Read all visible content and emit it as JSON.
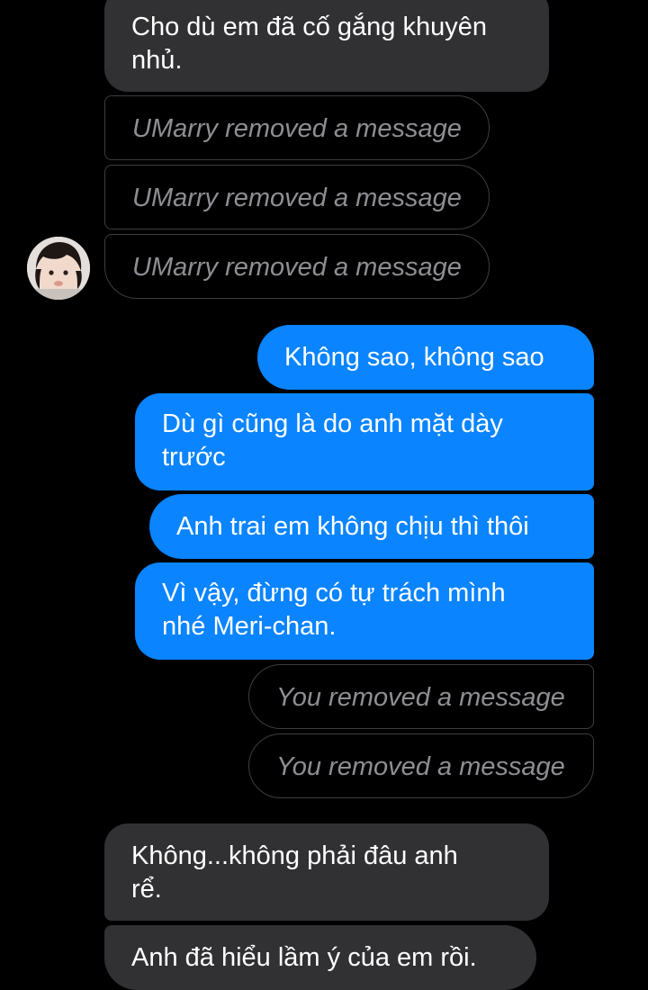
{
  "conversation": {
    "incoming_top": {
      "text_line1": "Cho dù em đã cố gắng khuyên",
      "text_line2": "nhủ."
    },
    "removed_incoming": [
      "UMarry removed a message",
      "UMarry removed a message",
      "UMarry removed a message"
    ],
    "outgoing": [
      {
        "line1": "Không sao, không sao",
        "line2": ""
      },
      {
        "line1": "Dù gì cũng là do anh mặt dày",
        "line2": "trước"
      },
      {
        "line1": "Anh trai em không chịu thì thôi",
        "line2": ""
      },
      {
        "line1": "Vì vậy, đừng có tự trách mình",
        "line2": "nhé Meri-chan."
      }
    ],
    "removed_outgoing": [
      "You removed a message",
      "You removed a message"
    ],
    "incoming_bottom": [
      {
        "line1": "Không...không phải đâu anh",
        "line2": "rể."
      },
      {
        "line1": "Anh đã hiểu lầm ý của em rồi.",
        "line2": ""
      }
    ]
  },
  "colors": {
    "background": "#000000",
    "incoming_bubble": "#313134",
    "outgoing_bubble": "#0a84ff",
    "removed_text": "#8e8e93"
  },
  "icons": {
    "avatar": "contact-avatar-photo"
  }
}
